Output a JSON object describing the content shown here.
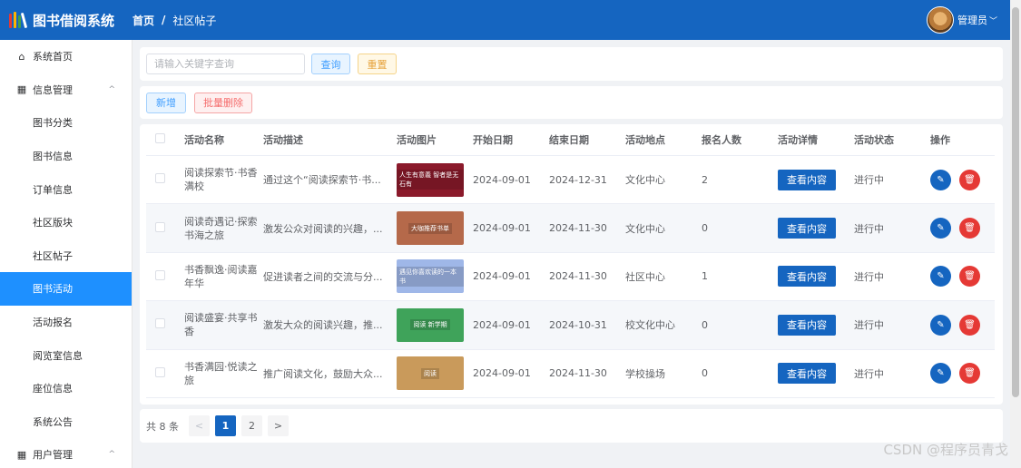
{
  "app": {
    "title": "图书借阅系统",
    "user": "管理员",
    "logo_colors": [
      "#e53935",
      "#ffb300",
      "#43a047",
      "#ffffff"
    ]
  },
  "breadcrumb": {
    "home": "首页",
    "separator": "/",
    "current": "社区帖子"
  },
  "sidebar": {
    "items": [
      {
        "label": "系统首页",
        "icon": "home-icon"
      },
      {
        "label": "信息管理",
        "icon": "grid-icon",
        "arrow": "^"
      },
      {
        "label": "图书分类"
      },
      {
        "label": "图书信息"
      },
      {
        "label": "订单信息"
      },
      {
        "label": "社区版块"
      },
      {
        "label": "社区帖子"
      },
      {
        "label": "图书活动",
        "active": true
      },
      {
        "label": "活动报名"
      },
      {
        "label": "阅览室信息"
      },
      {
        "label": "座位信息"
      },
      {
        "label": "系统公告"
      },
      {
        "label": "用户管理",
        "icon": "grid-icon",
        "arrow": "^"
      }
    ]
  },
  "search": {
    "placeholder": "请输入关键字查询",
    "query_label": "查询",
    "reset_label": "重置"
  },
  "actions": {
    "add_label": "新增",
    "batch_delete_label": "批量删除"
  },
  "table": {
    "headers": [
      "活动名称",
      "活动描述",
      "活动图片",
      "开始日期",
      "结束日期",
      "活动地点",
      "报名人数",
      "活动详情",
      "活动状态",
      "操作"
    ],
    "view_label": "查看内容",
    "rows": [
      {
        "name": "阅读探索节·书香满校",
        "desc": "通过这个“阅读探索节·书...",
        "img_text": "人生有意義 智者是无石有",
        "img_color": "#8b1a2b",
        "start": "2024-09-01",
        "end": "2024-12-31",
        "location": "文化中心",
        "count": "2",
        "status": "进行中"
      },
      {
        "name": "阅读奇遇记·探索书海之旅",
        "desc": "激发公众对阅读的兴趣，...",
        "img_text": "大咖推荐书单",
        "img_color": "#b5694a",
        "start": "2024-09-01",
        "end": "2024-11-30",
        "location": "文化中心",
        "count": "0",
        "status": "进行中"
      },
      {
        "name": "书香飘逸·阅读嘉年华",
        "desc": "促进读者之间的交流与分...",
        "img_text": "遇见你喜欢读的一本书",
        "img_color": "#9fb7e8",
        "start": "2024-09-01",
        "end": "2024-11-30",
        "location": "社区中心",
        "count": "1",
        "status": "进行中"
      },
      {
        "name": "阅读盛宴·共享书香",
        "desc": "激发大众的阅读兴趣，推...",
        "img_text": "阅读 新学期",
        "img_color": "#3fa35a",
        "start": "2024-09-01",
        "end": "2024-10-31",
        "location": "校文化中心",
        "count": "0",
        "status": "进行中"
      },
      {
        "name": "书香满园·悦读之旅",
        "desc": "推广阅读文化，鼓励大众...",
        "img_text": "阅读",
        "img_color": "#c99a5b",
        "start": "2024-09-01",
        "end": "2024-11-30",
        "location": "学校操场",
        "count": "0",
        "status": "进行中"
      }
    ]
  },
  "pagination": {
    "total": "共 8 条",
    "prev": "<",
    "pages": [
      "1",
      "2"
    ],
    "current": "1",
    "next": ">"
  },
  "watermark": "CSDN @程序员青戈"
}
